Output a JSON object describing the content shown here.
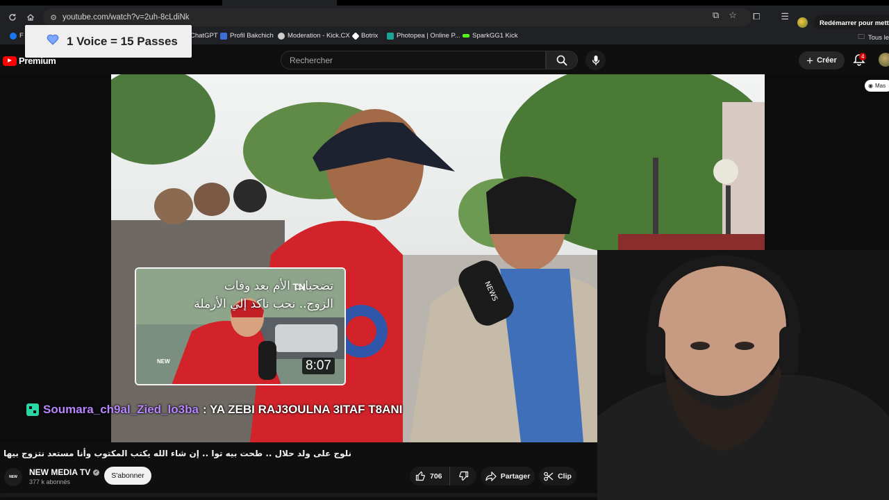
{
  "browser": {
    "url": "youtube.com/watch?v=2uh-8cLdiNk",
    "restart_label": "Redémarrer pour mettre à",
    "bookmarks": [
      {
        "label": "F",
        "color": "#1877f2"
      },
      {
        "label": "ChatGPT",
        "color": "#10a37f"
      },
      {
        "label": "Profil Bakchich",
        "color": "#3b6fd8"
      },
      {
        "label": "Moderation - Kick.CX",
        "color": "#cccccc"
      },
      {
        "label": "Botrix",
        "color": "#ffffff"
      },
      {
        "label": "Photopea | Online P...",
        "color": "#18a497"
      },
      {
        "label": "SparkGG1 Kick",
        "color": "#53fc18"
      }
    ],
    "all_bookmarks_label": "Tous le"
  },
  "overlay": {
    "voice_banner": "1 Voice = 15 Passes"
  },
  "youtube": {
    "logo_label": "Premium",
    "search_placeholder": "Rechercher",
    "create_label": "Créer",
    "notification_count": "4",
    "mask_label": "Mas"
  },
  "video": {
    "thumbnail_card": {
      "title_line1": "تضحيات الأم بعد وفات",
      "title_line2": "الزوج.. نحب ناكد إلي الأرملة",
      "tag": "TN",
      "brand": "NEW",
      "duration": "8:07"
    },
    "chat": {
      "username": "Soumara_ch9al_Zied_lo3ba",
      "message": ": YA ZEBI RAJ3OULNA 3ITAF T8ANI"
    },
    "title": "نلوج على ولد حلال .. طحت بيه توا .. إن شاء الله يكتب المكتوب وأنا مستعد نتزوج بيها",
    "channel": {
      "name": "NEW MEDIA TV",
      "subscribers": "377 k abonnés",
      "subscribe_label": "S'abonner",
      "avatar_text": "NEW"
    },
    "actions": {
      "likes": "706",
      "share_label": "Partager",
      "clip_label": "Clip"
    }
  },
  "colors": {
    "yt_red": "#ff0000",
    "chat_user": "#b986ff",
    "chat_badge": "#2bd6a6"
  }
}
